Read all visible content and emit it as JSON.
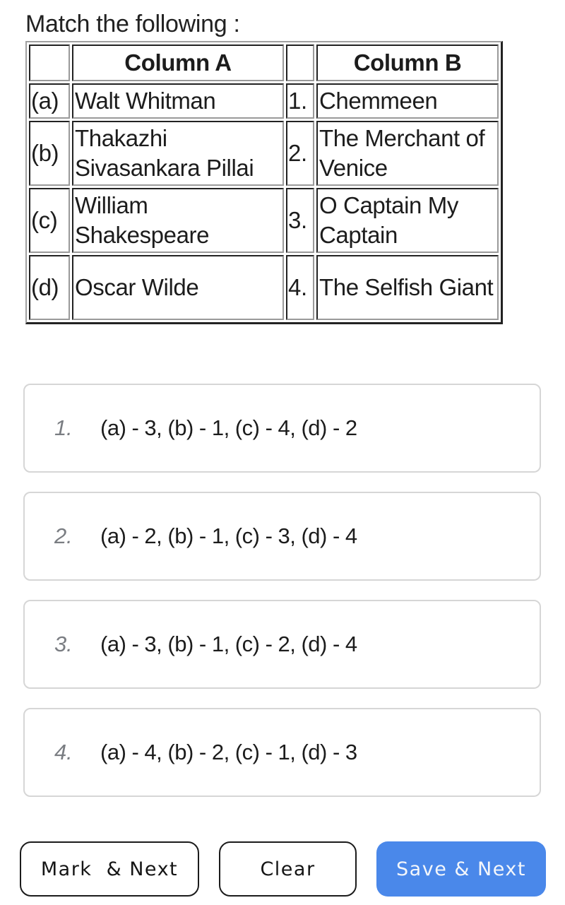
{
  "question": {
    "title": "Match the following :"
  },
  "table": {
    "headers": [
      "",
      "Column A",
      "",
      "Column B"
    ],
    "rows": [
      {
        "label_a": "(a)",
        "item_a": "Walt Whitman",
        "label_b": "1.",
        "item_b": "Chemmeen"
      },
      {
        "label_a": "(b)",
        "item_a": "Thakazhi Sivasankara Pillai",
        "label_b": "2.",
        "item_b": "The Merchant of Venice"
      },
      {
        "label_a": "(c)",
        "item_a": "William Shakespeare",
        "label_b": "3.",
        "item_b": "O Captain My Captain"
      },
      {
        "label_a": "(d)",
        "item_a": "Oscar Wilde",
        "label_b": "4.",
        "item_b": "The Selfish Giant"
      }
    ]
  },
  "options": [
    {
      "number": "1.",
      "text": "(a) - 3, (b) - 1, (c) - 4, (d) - 2"
    },
    {
      "number": "2.",
      "text": "(a) - 2, (b) - 1, (c) - 3, (d) - 4"
    },
    {
      "number": "3.",
      "text": "(a) - 3, (b) - 1, (c) - 2, (d) - 4"
    },
    {
      "number": "4.",
      "text": "(a) - 4, (b) - 2, (c) - 1, (d) - 3"
    }
  ],
  "actions": {
    "mark_next_label": "Mark  & Next",
    "clear_label": "Clear",
    "save_next_label": "Save & Next",
    "save_color": "#4a88ea"
  }
}
